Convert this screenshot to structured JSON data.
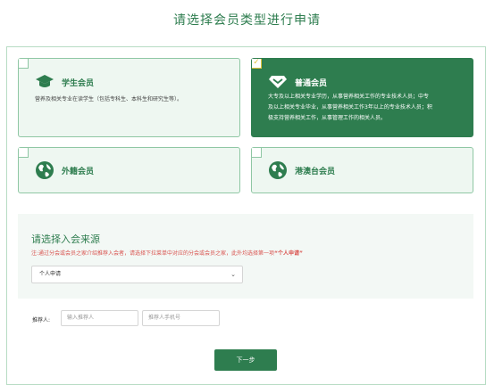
{
  "page": {
    "title": "请选择会员类型进行申请"
  },
  "member_types": [
    {
      "name": "学生会员",
      "icon": "graduation-cap-icon",
      "selected": false,
      "description": "营养及相关专业在读学生（包括专科生、本科生和研究生等）。"
    },
    {
      "name": "普通会员",
      "icon": "diamond-icon",
      "selected": true,
      "description_lines": [
        "大专及以上相关专业学历，从事营养相关工作的专业技术人员；中专",
        "及以上相关专业毕业，从事营养相关工作3年以上的专业技术人员；积",
        "极支持营养相关工作，从事管理工作的相关人员。"
      ]
    },
    {
      "name": "外籍会员",
      "icon": "globe-icon",
      "selected": false
    },
    {
      "name": "港澳台会员",
      "icon": "globe-icon",
      "selected": false
    }
  ],
  "source": {
    "title": "请选择入会来源",
    "note": "注:通过分会或会员之家介绍推荐入会者，请选择下拉菜单中对应的分会或会员之家，此外均选择第一项",
    "note_emphasis": "“个人申请”",
    "select_value": "个人申请"
  },
  "referrer": {
    "label": "推荐人:",
    "name_placeholder": "输入推荐人",
    "phone_placeholder": "推荐人手机号"
  },
  "next_button": "下一步",
  "colors": {
    "primary": "#2e7d4f",
    "light_bg": "#eef7f1",
    "warning": "#d9534f"
  }
}
